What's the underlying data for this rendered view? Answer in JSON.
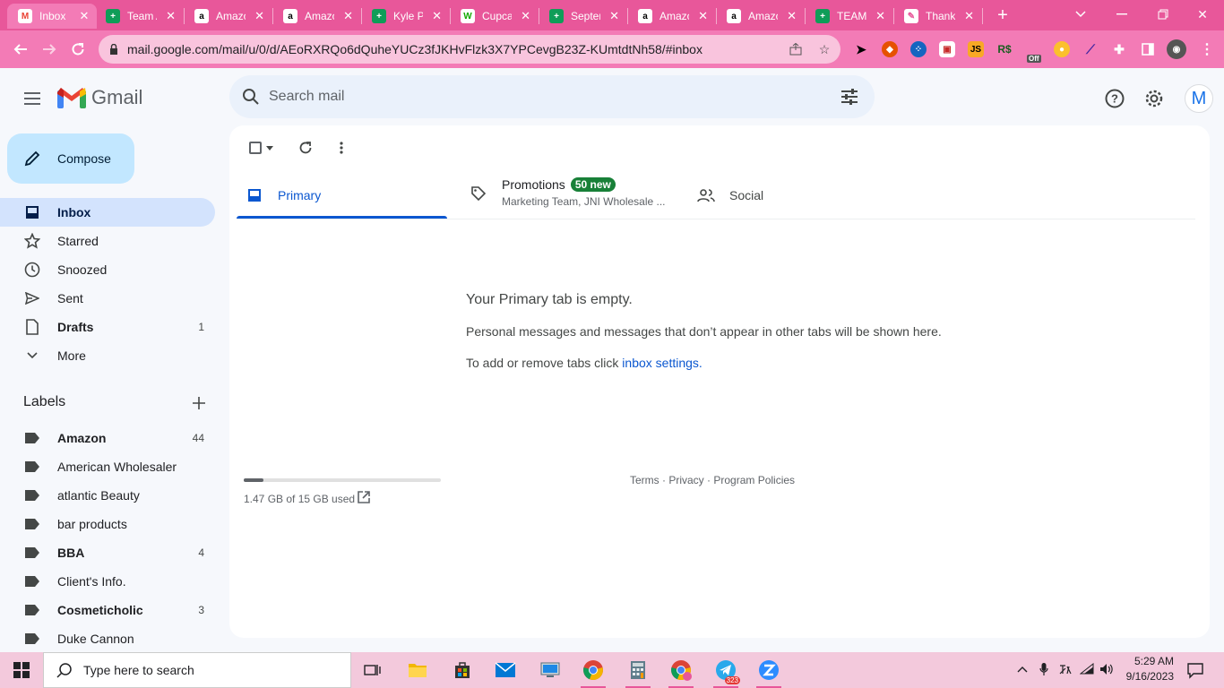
{
  "browser": {
    "tabs": [
      {
        "title": "Inbox",
        "favicon": "gmail-icon",
        "active": true
      },
      {
        "title": "Team A",
        "favicon": "sheets-icon"
      },
      {
        "title": "Amazon",
        "favicon": "amazon-icon"
      },
      {
        "title": "Amazon",
        "favicon": "amazon-icon"
      },
      {
        "title": "Kyle Pa",
        "favicon": "sheets-icon"
      },
      {
        "title": "Cupcake",
        "favicon": "upwork-icon"
      },
      {
        "title": "September",
        "favicon": "sheets-icon"
      },
      {
        "title": "Amazon",
        "favicon": "amazon-icon"
      },
      {
        "title": "Amazon",
        "favicon": "amazon-icon"
      },
      {
        "title": "TEAM",
        "favicon": "sheets-icon"
      },
      {
        "title": "Thank",
        "favicon": "thank-icon"
      }
    ],
    "url": "mail.google.com/mail/u/0/d/AEoRXRQo6dQuheYUCz3fJKHvFlzk3X7YPCevgB23Z-KUmtdtNh58/#inbox",
    "ext_badge": "Off",
    "ext_js": "JS"
  },
  "gmail": {
    "logo_text": "Gmail",
    "search_placeholder": "Search mail",
    "avatar_letter": "M",
    "compose_label": "Compose",
    "nav": [
      {
        "label": "Inbox",
        "count": "",
        "active": true
      },
      {
        "label": "Starred",
        "count": ""
      },
      {
        "label": "Snoozed",
        "count": ""
      },
      {
        "label": "Sent",
        "count": ""
      },
      {
        "label": "Drafts",
        "count": "1",
        "bold": true
      },
      {
        "label": "More",
        "count": ""
      }
    ],
    "labels_header": "Labels",
    "labels": [
      {
        "label": "Amazon",
        "count": "44",
        "bold": true
      },
      {
        "label": "American Wholesaler",
        "count": ""
      },
      {
        "label": "atlantic Beauty",
        "count": ""
      },
      {
        "label": "bar products",
        "count": ""
      },
      {
        "label": "BBA",
        "count": "4",
        "bold": true
      },
      {
        "label": "Client's Info.",
        "count": ""
      },
      {
        "label": "Cosmeticholic",
        "count": "3",
        "bold": true
      },
      {
        "label": "Duke Cannon",
        "count": ""
      }
    ],
    "category_tabs": {
      "primary": "Primary",
      "promotions": "Promotions",
      "promotions_badge": "50 new",
      "promotions_senders": "Marketing Team, JNI Wholesale ...",
      "social": "Social"
    },
    "empty_state": {
      "title": "Your Primary tab is empty.",
      "line1": "Personal messages and messages that don’t appear in other tabs will be shown here.",
      "line2_prefix": "To add or remove tabs click ",
      "line2_link": "inbox settings",
      "line2_suffix": "."
    },
    "storage": {
      "text": "1.47 GB of 15 GB used",
      "fraction_used": 0.098
    },
    "footer": {
      "terms": "Terms",
      "privacy": "Privacy",
      "policies": "Program Policies",
      "sep": " · "
    }
  },
  "taskbar": {
    "search_placeholder": "Type here to search",
    "time": "5:29 AM",
    "date": "9/16/2023",
    "telegram_badge": "323"
  }
}
